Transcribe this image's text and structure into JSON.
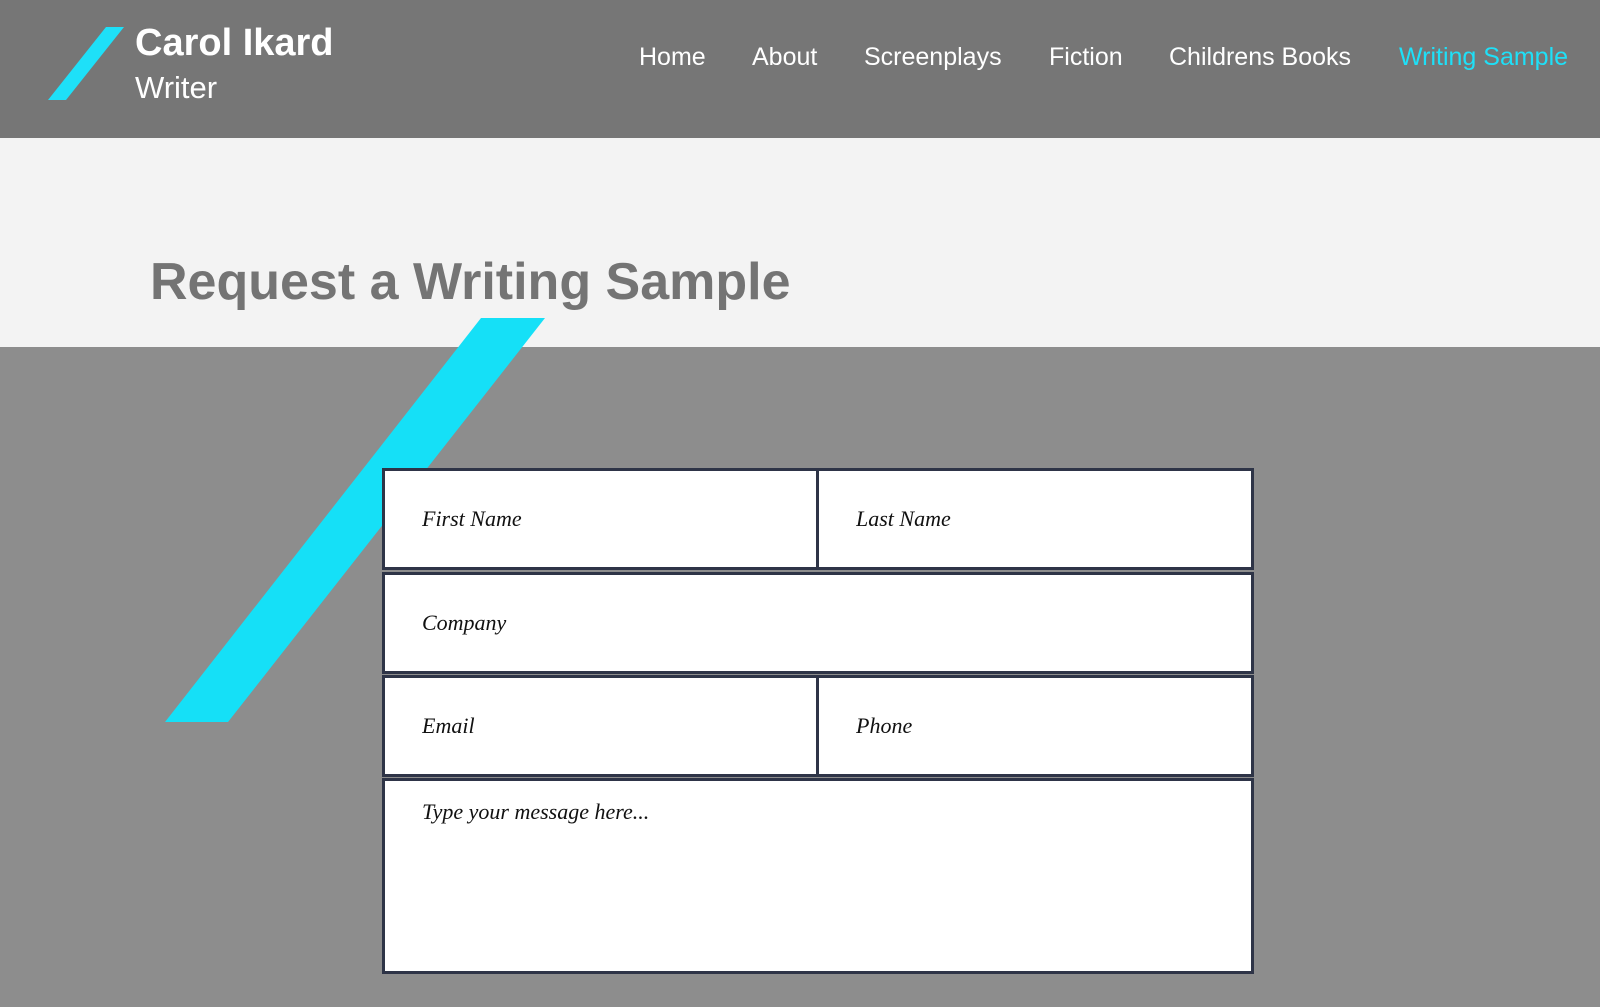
{
  "header": {
    "brand_name": "Carol Ikard",
    "brand_subtitle": "Writer",
    "nav": [
      {
        "label": "Home"
      },
      {
        "label": "About"
      },
      {
        "label": "Screenplays"
      },
      {
        "label": "Fiction"
      },
      {
        "label": "Childrens Books"
      },
      {
        "label": "Writing Sample",
        "active": true
      }
    ],
    "logo_icon": "slash-logo-icon"
  },
  "main": {
    "page_title": "Request a Writing Sample",
    "decor_icon": "slash-decoration-icon"
  },
  "form": {
    "first_name_placeholder": "First Name",
    "last_name_placeholder": "Last Name",
    "company_placeholder": "Company",
    "email_placeholder": "Email",
    "phone_placeholder": "Phone",
    "message_placeholder": "Type your message here..."
  },
  "colors": {
    "accent": "#1ee0f8",
    "header_bg": "#767676",
    "title_band_bg": "#f3f3f3",
    "page_bg": "#8d8d8d",
    "field_border": "#2e3447"
  }
}
